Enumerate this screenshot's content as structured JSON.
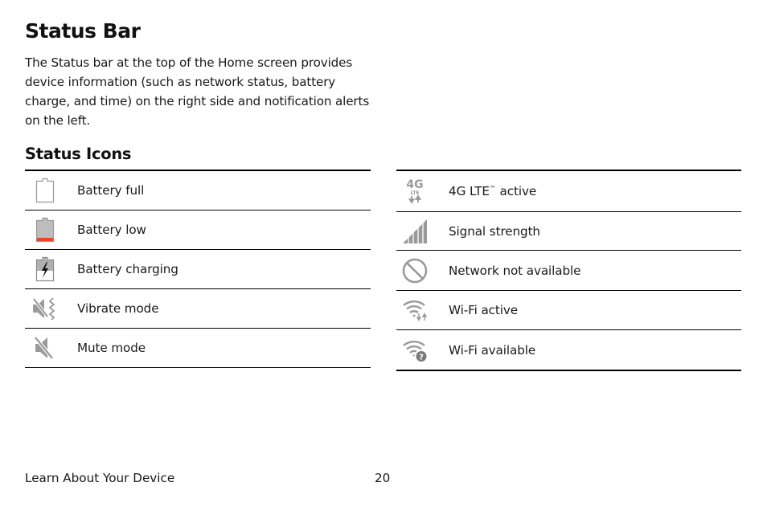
{
  "page": {
    "title": "Status Bar",
    "intro": "The Status bar at the top of the Home screen provides device information (such as network status, battery charge, and time) on the right side and notification alerts on the left.",
    "section_title": "Status Icons"
  },
  "colors": {
    "icon_gray": "#a0a0a0",
    "battery_fill": "#bdbdbd",
    "battery_low_bar": "#e8452c",
    "rule": "#000000"
  },
  "left_table": [
    {
      "icon": "battery-full-icon",
      "label": "Battery full"
    },
    {
      "icon": "battery-low-icon",
      "label": "Battery low"
    },
    {
      "icon": "battery-charging-icon",
      "label": "Battery charging"
    },
    {
      "icon": "vibrate-mode-icon",
      "label": "Vibrate mode"
    },
    {
      "icon": "mute-mode-icon",
      "label": "Mute mode"
    }
  ],
  "right_table": [
    {
      "icon": "4g-lte-icon",
      "label": "4G LTE",
      "label_sup": "™",
      "label_suffix": " active",
      "icon_text": "4G",
      "icon_subtext": "LTE"
    },
    {
      "icon": "signal-strength-icon",
      "label": "Signal strength"
    },
    {
      "icon": "network-not-available-icon",
      "label": "Network not available"
    },
    {
      "icon": "wifi-active-icon",
      "label": "Wi-Fi active"
    },
    {
      "icon": "wifi-available-icon",
      "label": "Wi-Fi available"
    }
  ],
  "footer": {
    "section": "Learn About Your Device",
    "page_number": "20"
  }
}
